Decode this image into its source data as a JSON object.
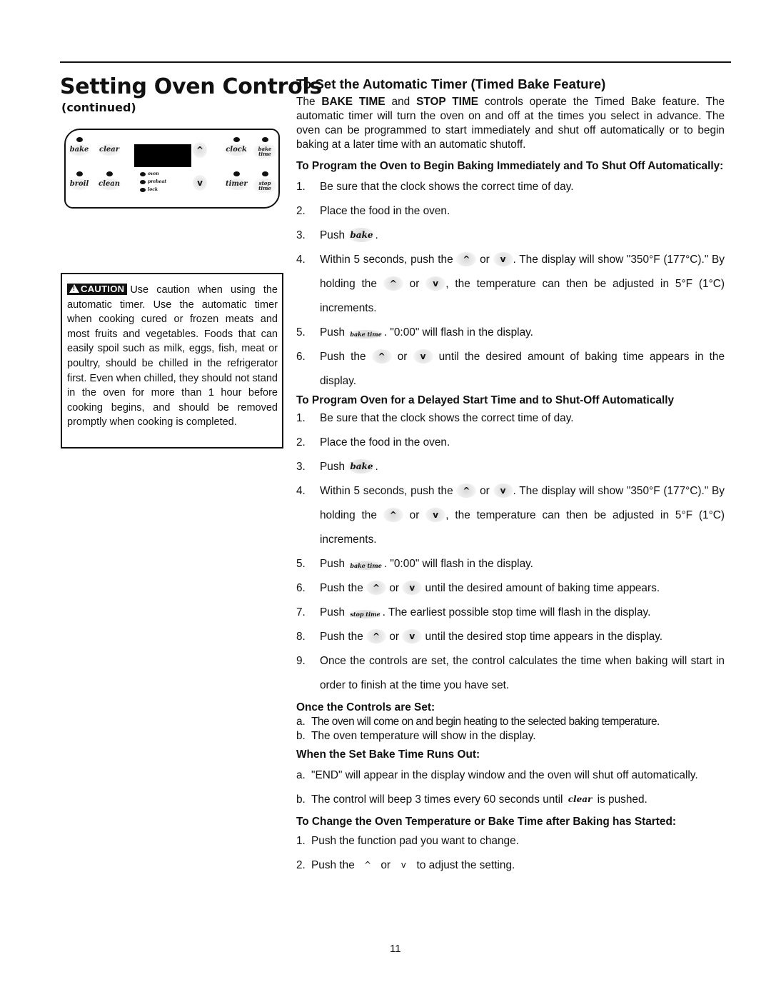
{
  "page": {
    "title": "Setting Oven Controls",
    "subtitle": "(continued)",
    "page_number": "11"
  },
  "control_panel": {
    "top_row": [
      {
        "label": "bake",
        "has_led": true
      },
      {
        "label": "clear",
        "has_led": false
      },
      {
        "label": "clock",
        "has_led": true
      },
      {
        "label": "bake time",
        "has_led": true
      }
    ],
    "bottom_row": [
      {
        "label": "broil",
        "has_led": true
      },
      {
        "label": "clean",
        "has_led": true
      },
      {
        "label": "timer",
        "has_led": true
      },
      {
        "label": "stop time",
        "has_led": true
      }
    ],
    "status_leds": [
      "oven",
      "preheat",
      "lock"
    ],
    "up_arrow": "^",
    "down_arrow": "v"
  },
  "caution": {
    "badge": "CAUTION",
    "text": "Use caution when using the automatic timer. Use the automatic timer when cooking cured or frozen meats and most fruits and vegetables. Foods that can easily spoil such as milk, eggs, fish, meat or poultry, should be chilled in the refrigerator first. Even when chilled, they should not stand in the oven for more than 1 hour before cooking begins, and should be removed promptly when cooking is completed."
  },
  "main": {
    "heading": "To Set the Automatic Timer (Timed Bake Feature)",
    "intro": {
      "pre": "The ",
      "bold1": "BAKE TIME",
      "mid": " and ",
      "bold2": "STOP TIME",
      "post": " controls operate the Timed Bake feature. The automatic timer will turn the oven on and off at the times you select in advance. The oven can be programmed to start immediately and shut off automatically or to begin baking at a later time with an automatic shutoff."
    },
    "keys": {
      "bake": "bake",
      "bake_time": "bake time",
      "stop_time": "stop time",
      "up": "^",
      "down": "v",
      "clear": "clear",
      "or": "or"
    },
    "immediate": {
      "heading": "To Program the Oven to Begin Baking Immediately and To Shut Off Automatically:",
      "steps": [
        {
          "num": "1.",
          "text": "Be sure that the clock shows the correct time of day."
        },
        {
          "num": "2.",
          "text": "Place the food in the oven."
        },
        {
          "num": "3.",
          "pre": "Push ",
          "post": "."
        },
        {
          "num": "4.",
          "pre": "Within 5 seconds, push the ",
          "mid": ". The display will show \"350°F (177°C).\" By holding the ",
          "post": ", the temperature can then be adjusted in 5°F (1°C) increments."
        },
        {
          "num": "5.",
          "pre": "Push ",
          "post": ". \"0:00\" will flash in the display."
        },
        {
          "num": "6.",
          "pre": "Push the ",
          "post": " until the desired amount of baking time appears in the display."
        }
      ]
    },
    "delayed": {
      "heading": "To Program Oven for a Delayed Start Time and to Shut-Off Automatically",
      "steps": [
        {
          "num": "1.",
          "text": "Be sure that the clock shows the correct time of day."
        },
        {
          "num": "2.",
          "text": "Place the food in the oven."
        },
        {
          "num": "3.",
          "pre": "Push ",
          "post": "."
        },
        {
          "num": "4.",
          "pre": "Within 5 seconds, push the ",
          "mid": ". The display will show \"350°F (177°C).\" By holding the ",
          "post": ", the temperature can then be adjusted in 5°F (1°C) increments."
        },
        {
          "num": "5.",
          "pre": "Push ",
          "post": ". \"0:00\" will flash in the display."
        },
        {
          "num": "6.",
          "pre": "Push the ",
          "post": " until the desired amount of baking time appears."
        },
        {
          "num": "7.",
          "pre": "Push ",
          "post": ". The earliest possible stop time will flash in the display."
        },
        {
          "num": "8.",
          "pre": "Push the ",
          "post": " until the desired stop time appears in the display."
        },
        {
          "num": "9.",
          "text": "Once the controls are set, the control calculates the time when baking will start in order to finish at the time you have set."
        }
      ]
    },
    "once_set": {
      "heading": "Once the Controls are Set:",
      "items": [
        {
          "num": "a.",
          "text": "The oven will come on and begin heating to the selected baking temperature."
        },
        {
          "num": "b.",
          "text": "The oven temperature will show in the display."
        }
      ]
    },
    "runs_out": {
      "heading": "When the Set Bake Time Runs Out:",
      "items": [
        {
          "num": "a.",
          "text": "\"END\" will appear in the display window and the oven will shut off automatically."
        },
        {
          "num": "b.",
          "pre": "The control will beep 3 times every 60 seconds until ",
          "post": " is pushed."
        }
      ]
    },
    "change": {
      "heading": "To Change the Oven Temperature or Bake Time after Baking has Started:",
      "items": [
        {
          "num": "1.",
          "text": "Push the function pad you want to change."
        },
        {
          "num": "2.",
          "pre": "Push the ",
          "post": " to adjust the setting."
        }
      ]
    }
  }
}
